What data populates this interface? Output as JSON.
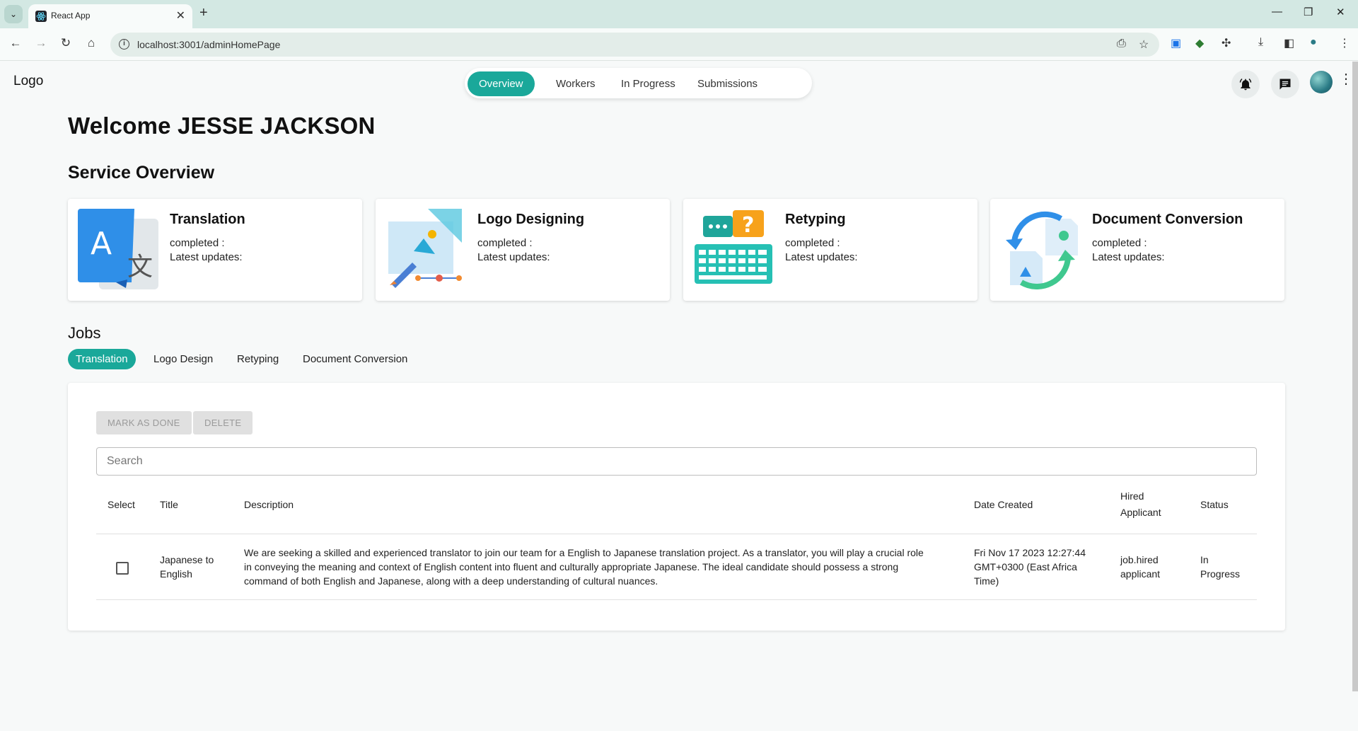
{
  "browser": {
    "tab_title": "React App",
    "url": "localhost:3001/adminHomePage",
    "new_tab": "+",
    "close_tab": "✕"
  },
  "header": {
    "logo": "Logo",
    "nav": [
      "Overview",
      "Workers",
      "In Progress",
      "Submissions"
    ],
    "active_nav": "Overview"
  },
  "welcome": "Welcome JESSE JACKSON",
  "service_overview": {
    "title": "Service Overview",
    "cards": [
      {
        "title": "Translation",
        "completed": "completed :",
        "updates": "Latest updates:"
      },
      {
        "title": "Logo Designing",
        "completed": "completed :",
        "updates": "Latest updates:"
      },
      {
        "title": "Retyping",
        "completed": "completed :",
        "updates": "Latest updates:"
      },
      {
        "title": "Document Conversion",
        "completed": "completed :",
        "updates": "Latest updates:"
      }
    ]
  },
  "jobs": {
    "title": "Jobs",
    "tabs": [
      "Translation",
      "Logo Design",
      "Retyping",
      "Document Conversion"
    ],
    "active_tab": "Translation",
    "mark_done_label": "MARK AS DONE",
    "delete_label": "DELETE",
    "search_placeholder": "Search",
    "columns": {
      "select": "Select",
      "title": "Title",
      "description": "Description",
      "date_created": "Date Created",
      "hired_applicant_1": "Hired",
      "hired_applicant_2": "Applicant",
      "status": "Status"
    },
    "rows": [
      {
        "title_1": "Japanese to",
        "title_2": "English",
        "description_1": "We are seeking a skilled and experienced translator to join our team for a English to Japanese translation project. As a translator, you will play a crucial role",
        "description_2": "in conveying the meaning and context of English content into fluent and culturally appropriate Japanese. The ideal candidate should possess a strong",
        "description_3": "command of both English and Japanese, along with a deep understanding of cultural nuances.",
        "date_1": "Fri Nov 17 2023 12:27:44",
        "date_2": "GMT+0300 (East Africa",
        "date_3": "Time)",
        "hired_1": "job.hired",
        "hired_2": "applicant",
        "status_1": "In",
        "status_2": "Progress",
        "selected": false
      }
    ]
  },
  "colors": {
    "accent": "#1aa89a",
    "background": "#f7f9f9",
    "chrome_tabbar": "#d3e8e3"
  }
}
